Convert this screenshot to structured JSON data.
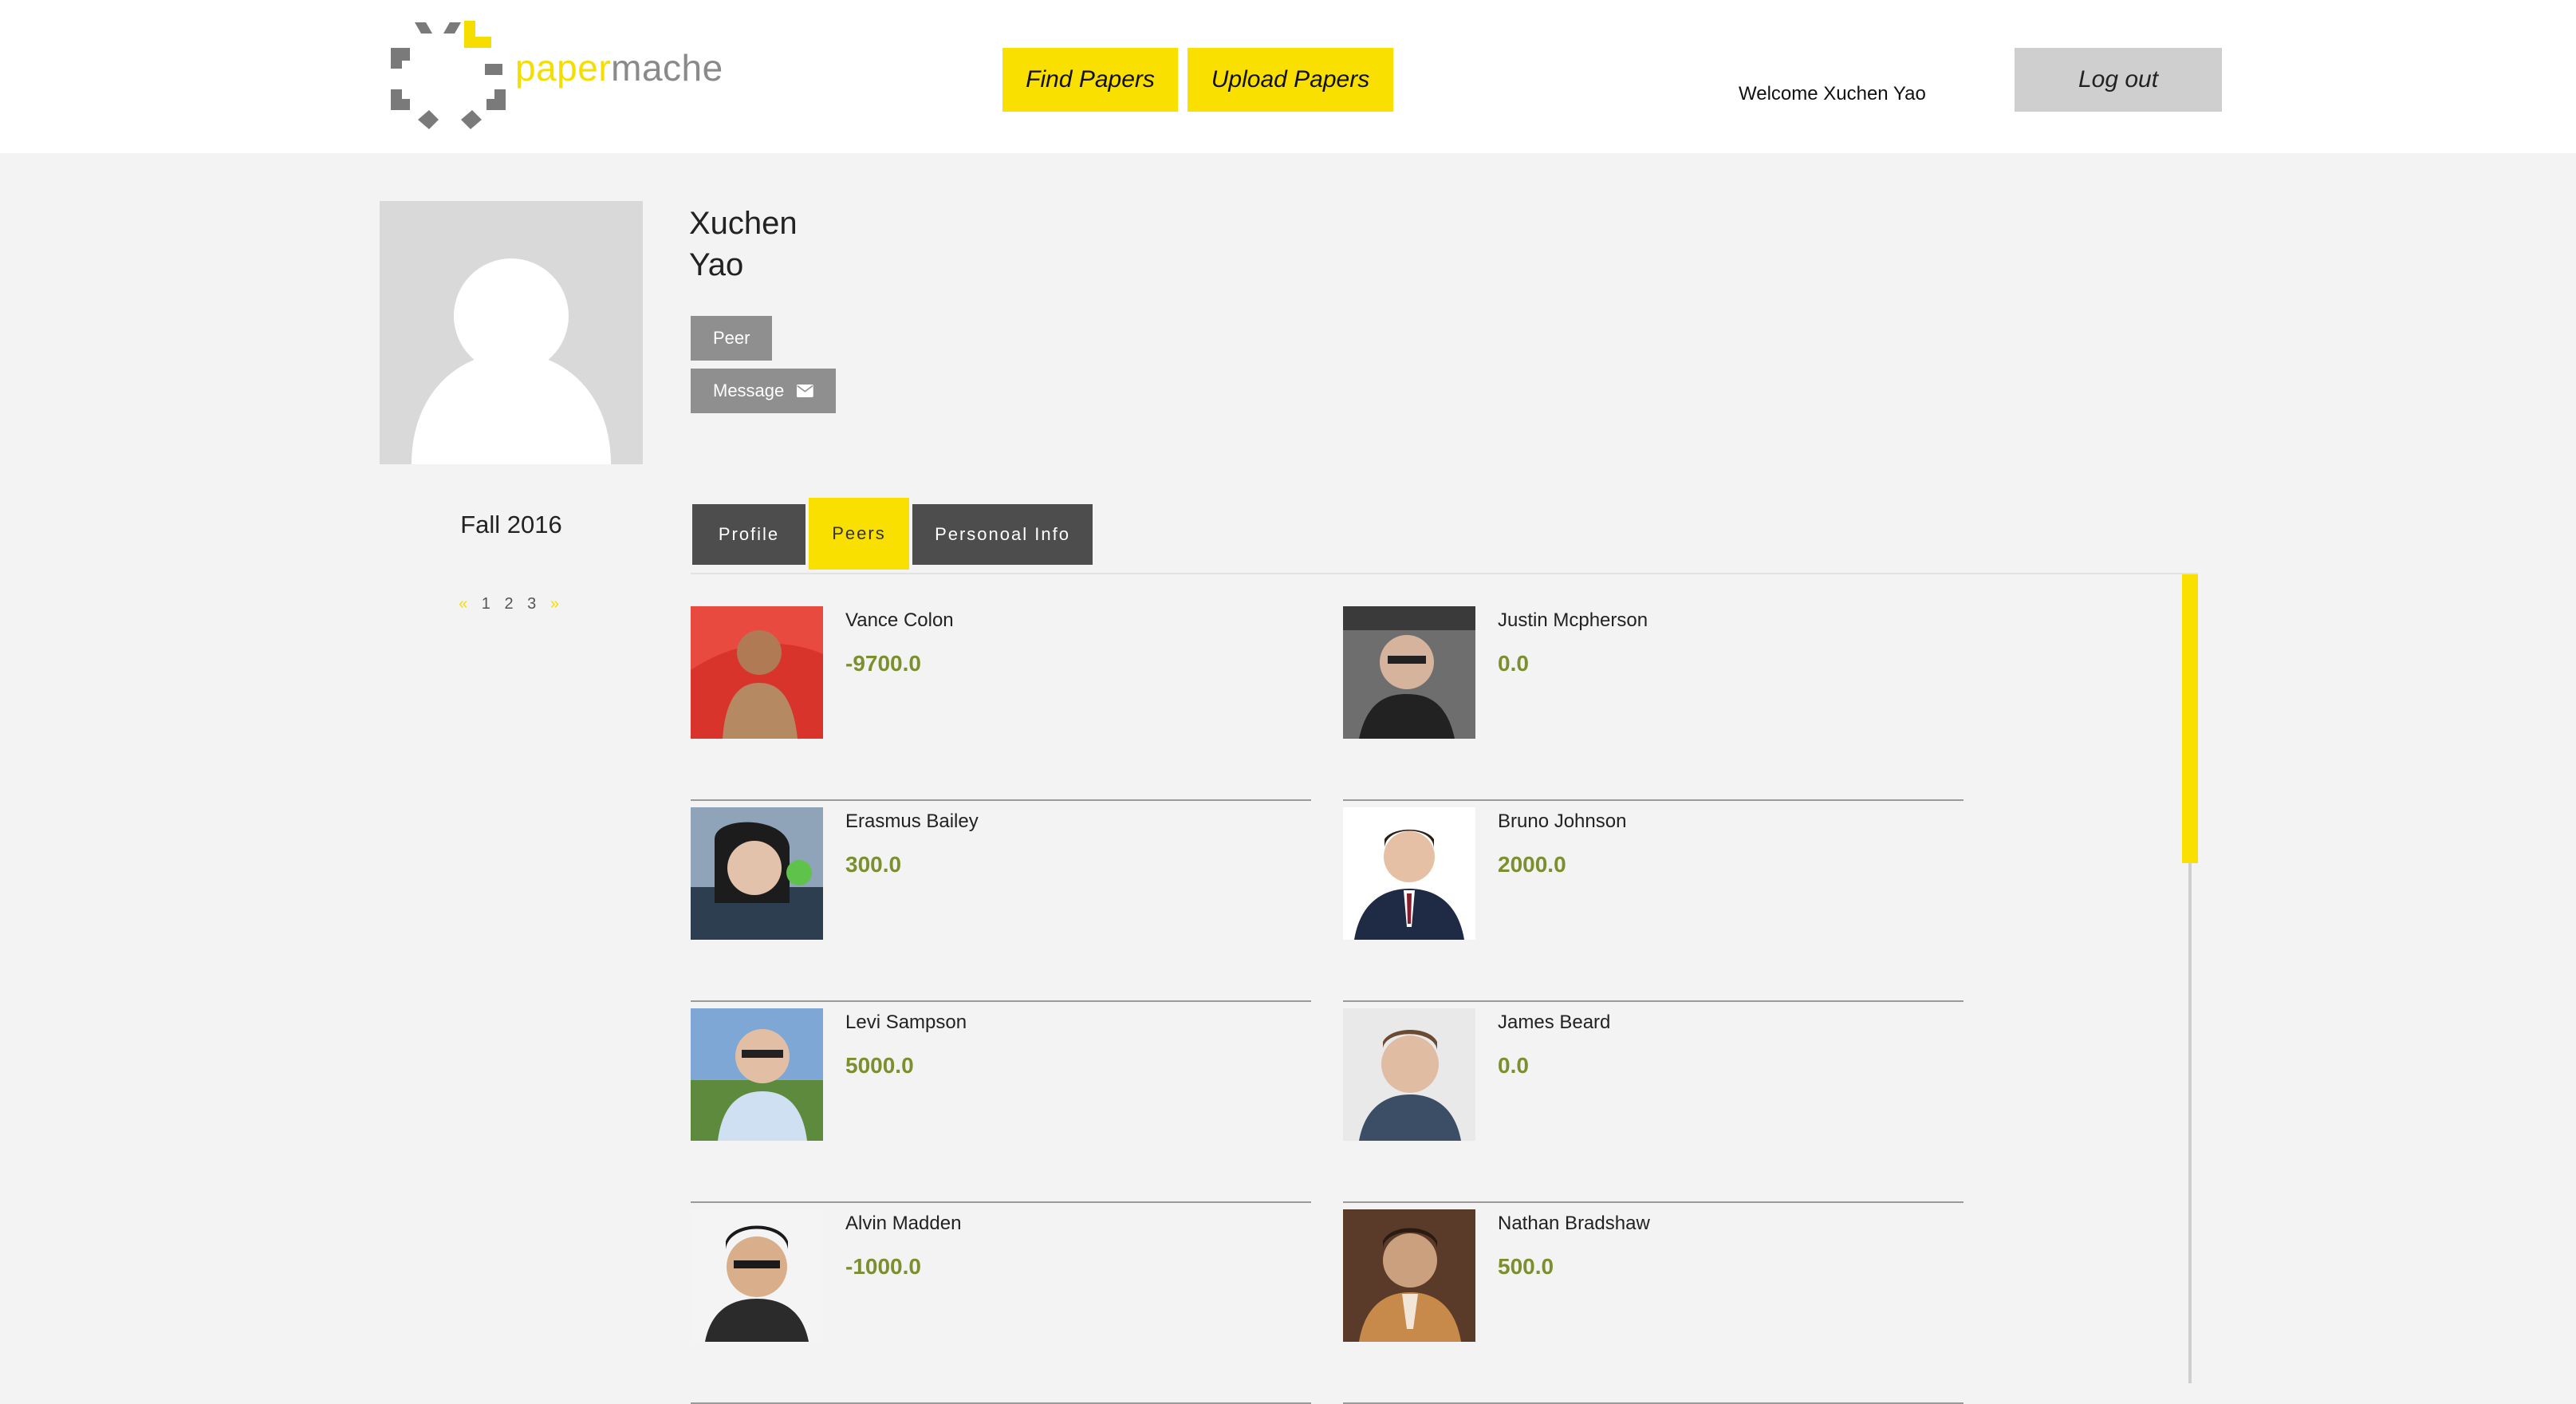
{
  "header": {
    "logo_text_part1": "paper",
    "logo_text_part2": "mache",
    "find_label": "Find Papers",
    "upload_label": "Upload Papers",
    "welcome_text": "Welcome Xuchen Yao",
    "logout_label": "Log out"
  },
  "profile": {
    "first_name": "Xuchen",
    "last_name": "Yao",
    "peer_label": "Peer",
    "message_label": "Message",
    "term": "Fall 2016",
    "pager": {
      "prev": "«",
      "pages": [
        "1",
        "2",
        "3"
      ],
      "next": "»"
    }
  },
  "tabs": [
    {
      "label": "Profile",
      "active": false
    },
    {
      "label": "Peers",
      "active": true
    },
    {
      "label": "Personoal Info",
      "active": false
    }
  ],
  "peers": [
    {
      "name": "Vance Colon",
      "score": "-9700.0"
    },
    {
      "name": "Justin Mcpherson",
      "score": "0.0"
    },
    {
      "name": "Erasmus Bailey",
      "score": "300.0"
    },
    {
      "name": "Bruno Johnson",
      "score": "2000.0"
    },
    {
      "name": "Levi Sampson",
      "score": "5000.0"
    },
    {
      "name": "James Beard",
      "score": "0.0"
    },
    {
      "name": "Alvin Madden",
      "score": "-1000.0"
    },
    {
      "name": "Nathan Bradshaw",
      "score": "500.0"
    }
  ],
  "colors": {
    "accent_yellow": "#fae000",
    "score_green": "#7b8f2e",
    "tab_dark": "#4d4d4d",
    "button_gray": "#8f8f8f"
  },
  "icons": [
    "logo-icon",
    "envelope-icon",
    "default-avatar-icon"
  ]
}
